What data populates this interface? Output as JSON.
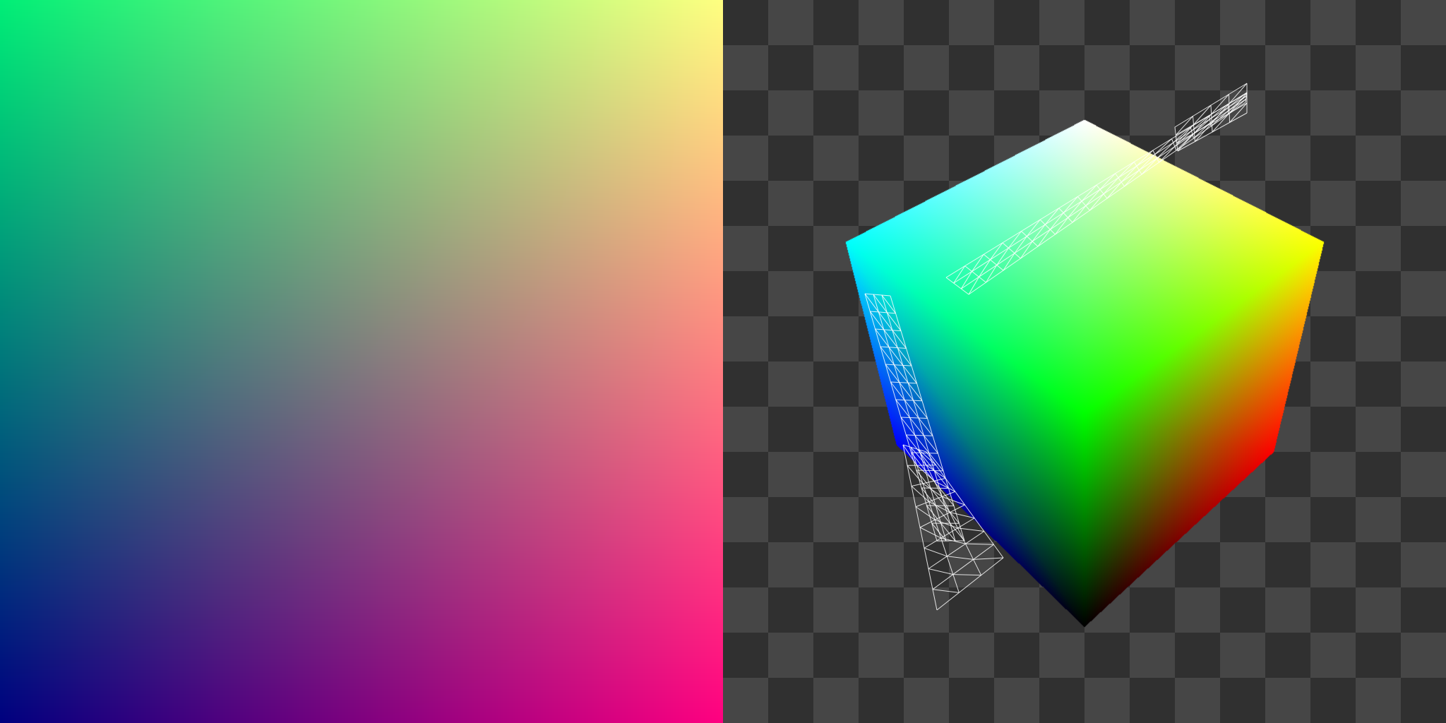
{
  "gradient_panel": {
    "corner_colors": {
      "top_left": "#00ee77",
      "top_right": "#ffff80",
      "bottom_left": "#00007f",
      "bottom_right": "#ff0080"
    }
  },
  "viewport_panel": {
    "checker_colors": [
      "#464646",
      "#303030"
    ],
    "cube": {
      "vertex_colors": {
        "top": "#ffffff",
        "left": "#00ffff",
        "right": "#ffff00",
        "front_top": "#00ff00",
        "front_left_bottom": "#0000ff",
        "front_right_bottom": "#ff0000",
        "bottom": "#000000"
      }
    },
    "wireframe": {
      "color": "#ffffff",
      "opacity": 0.85
    }
  }
}
